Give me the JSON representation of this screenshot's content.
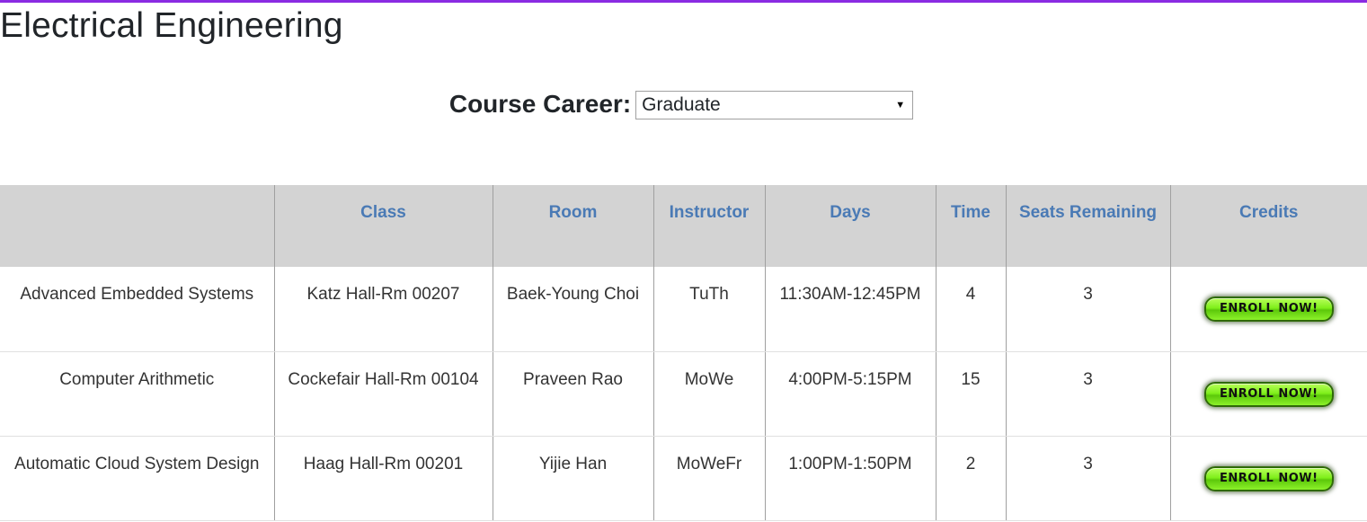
{
  "page": {
    "title": "Electrical Engineering",
    "accent_color": "#8a2be2"
  },
  "filter": {
    "label": "Course Career:",
    "selected": "Graduate"
  },
  "table": {
    "headers": [
      "",
      "Class",
      "Room",
      "Instructor",
      "Days",
      "Time",
      "Seats Remaining",
      "Credits"
    ],
    "header_text_color": "#4a7ab5",
    "rows": [
      {
        "course": "Advanced Embedded Systems",
        "class": "Katz Hall-Rm 00207",
        "room": "Baek-Young Choi",
        "instructor": "TuTh",
        "days": "11:30AM-12:45PM",
        "time": "4",
        "seats": "3",
        "action": "ENROLL NOW!"
      },
      {
        "course": "Computer Arithmetic",
        "class": "Cockefair Hall-Rm 00104",
        "room": "Praveen Rao",
        "instructor": "MoWe",
        "days": "4:00PM-5:15PM",
        "time": "15",
        "seats": "3",
        "action": "ENROLL NOW!"
      },
      {
        "course": "Automatic Cloud System Design",
        "class": "Haag Hall-Rm 00201",
        "room": "Yijie Han",
        "instructor": "MoWeFr",
        "days": "1:00PM-1:50PM",
        "time": "2",
        "seats": "3",
        "action": "ENROLL NOW!"
      }
    ]
  }
}
